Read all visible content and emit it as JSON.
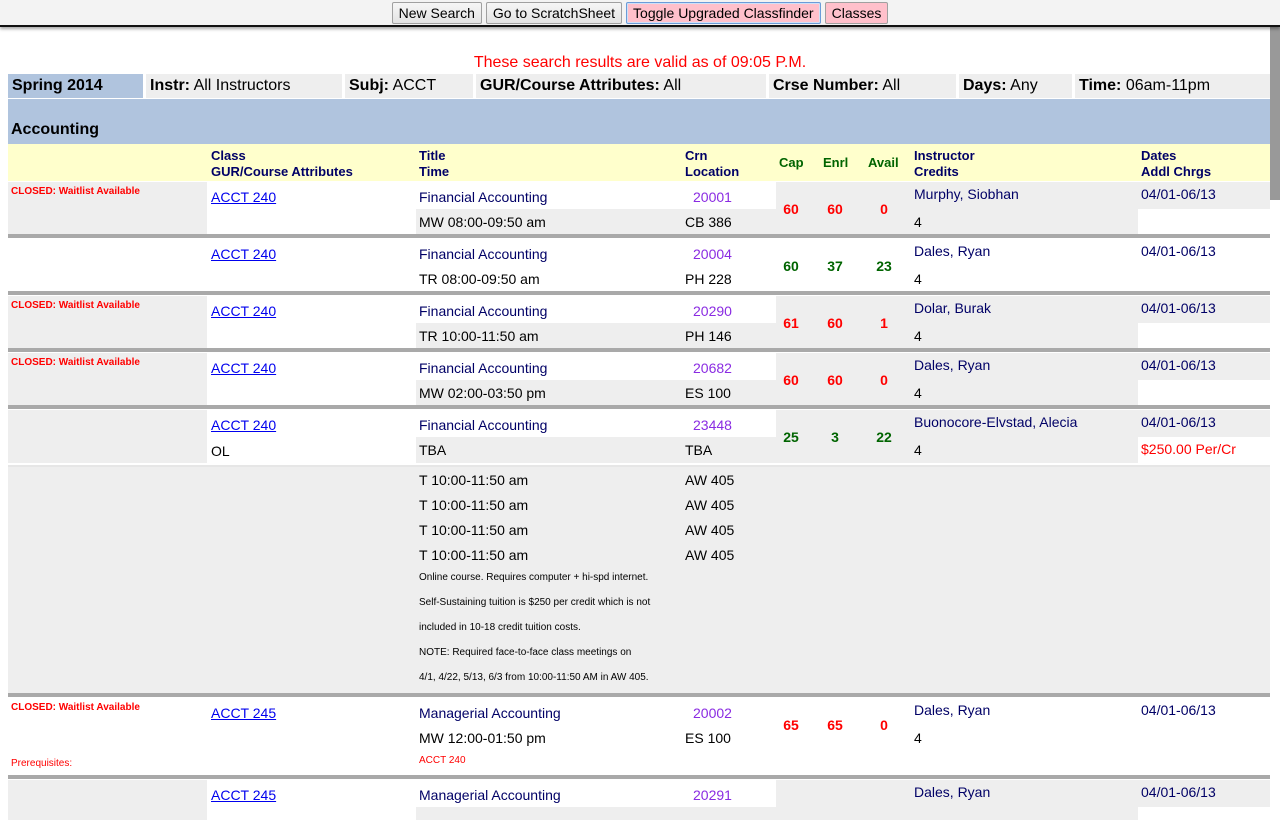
{
  "toolbar": {
    "new_search": "New Search",
    "scratchsheet": "Go to ScratchSheet",
    "toggle_classfinder": "Toggle Upgraded Classfinder",
    "classes": "Classes"
  },
  "validity": "These search results are valid as of 09:05 P.M.",
  "criteria": {
    "term": "Spring 2014",
    "instr_label": "Instr:",
    "instr_value": "All Instructors",
    "subj_label": "Subj:",
    "subj_value": "ACCT",
    "gur_label": "GUR/Course Attributes:",
    "gur_value": "All",
    "crse_label": "Crse Number:",
    "crse_value": "All",
    "days_label": "Days:",
    "days_value": "Any",
    "time_label": "Time:",
    "time_value": "06am-11pm"
  },
  "subject": "Accounting",
  "headers": {
    "class": "Class",
    "gur": "GUR/Course Attributes",
    "title": "Title",
    "time": "Time",
    "crn": "Crn",
    "location": "Location",
    "cap": "Cap",
    "enrl": "Enrl",
    "avail": "Avail",
    "instructor": "Instructor",
    "credits": "Credits",
    "dates": "Dates",
    "addl": "Addl Chrgs"
  },
  "courses": [
    {
      "status": "CLOSED: Waitlist Available",
      "class": "ACCT 240",
      "attr": "",
      "title": "Financial Accounting",
      "time": "MW 08:00-09:50 am",
      "crn": "20001",
      "location": "CB 386",
      "cap": "60",
      "enrl": "60",
      "avail": "0",
      "instructor": "Murphy, Siobhan",
      "credits": "4",
      "dates": "04/01-06/13",
      "charge": ""
    },
    {
      "status": "",
      "class": "ACCT 240",
      "attr": "",
      "title": "Financial Accounting",
      "time": "TR 08:00-09:50 am",
      "crn": "20004",
      "location": "PH 228",
      "cap": "60",
      "enrl": "37",
      "avail": "23",
      "instructor": "Dales, Ryan",
      "credits": "4",
      "dates": "04/01-06/13",
      "charge": ""
    },
    {
      "status": "CLOSED: Waitlist Available",
      "class": "ACCT 240",
      "attr": "",
      "title": "Financial Accounting",
      "time": "TR 10:00-11:50 am",
      "crn": "20290",
      "location": "PH 146",
      "cap": "61",
      "enrl": "60",
      "avail": "1",
      "instructor": "Dolar, Burak",
      "credits": "4",
      "dates": "04/01-06/13",
      "charge": ""
    },
    {
      "status": "CLOSED: Waitlist Available",
      "class": "ACCT 240",
      "attr": "",
      "title": "Financial Accounting",
      "time": "MW 02:00-03:50 pm",
      "crn": "20682",
      "location": "ES 100",
      "cap": "60",
      "enrl": "60",
      "avail": "0",
      "instructor": "Dales, Ryan",
      "credits": "4",
      "dates": "04/01-06/13",
      "charge": ""
    },
    {
      "status": "",
      "class": "ACCT 240",
      "attr": "OL",
      "title": "Financial Accounting",
      "time": "TBA",
      "crn": "23448",
      "location": "TBA",
      "cap": "25",
      "enrl": "3",
      "avail": "22",
      "instructor": "Buonocore-Elvstad, Alecia",
      "credits": "4",
      "dates": "04/01-06/13",
      "charge": "$250.00 Per/Cr",
      "meetings": [
        {
          "time": "T 10:00-11:50 am",
          "location": "AW 405"
        },
        {
          "time": "T 10:00-11:50 am",
          "location": "AW 405"
        },
        {
          "time": "T 10:00-11:50 am",
          "location": "AW 405"
        },
        {
          "time": "T 10:00-11:50 am",
          "location": "AW 405"
        }
      ],
      "notes": [
        "Online course. Requires computer + hi-spd internet.",
        "Self-Sustaining tuition is $250 per credit which is not",
        "included in 10-18 credit tuition costs.",
        "NOTE: Required face-to-face class meetings on",
        "4/1, 4/22, 5/13, 6/3 from 10:00-11:50 AM in AW 405."
      ]
    },
    {
      "status": "CLOSED: Waitlist Available",
      "prereq_label": "Prerequisites:",
      "prereq": "ACCT 240",
      "class": "ACCT 245",
      "attr": "",
      "title": "Managerial Accounting",
      "time": "MW 12:00-01:50 pm",
      "crn": "20002",
      "location": "ES 100",
      "cap": "65",
      "enrl": "65",
      "avail": "0",
      "instructor": "Dales, Ryan",
      "credits": "4",
      "dates": "04/01-06/13",
      "charge": ""
    },
    {
      "status": "",
      "class": "ACCT 245",
      "attr": "",
      "title": "Managerial Accounting",
      "time": "",
      "crn": "20291",
      "location": "",
      "cap": "",
      "enrl": "",
      "avail": "",
      "instructor": "Dales, Ryan",
      "credits": "",
      "dates": "04/01-06/13",
      "charge": ""
    }
  ]
}
